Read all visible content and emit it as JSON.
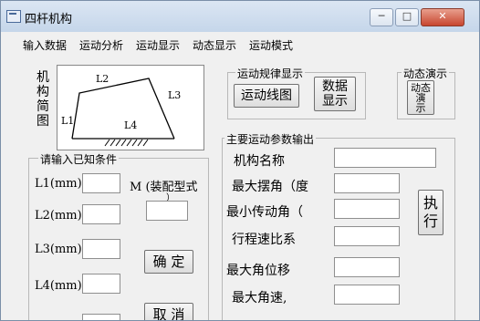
{
  "window": {
    "title": "四杆机构",
    "minimize_glyph": "─",
    "maximize_glyph": "□",
    "close_glyph": "✕"
  },
  "menu": [
    "输入数据",
    "运动分析",
    "运动显示",
    "动态显示",
    "运动模式"
  ],
  "diagram": {
    "caption": "机构简图",
    "labels": {
      "l1": "L1",
      "l2": "L2",
      "l3": "L3",
      "l4": "L4"
    }
  },
  "motion_display": {
    "title": "运动规律显示",
    "diagram_button": "运动线图",
    "data_button_l1": "数据",
    "data_button_l2": "显示"
  },
  "dynamic_demo": {
    "title": "动态演示",
    "button_l1": "动态",
    "button_l2": "演",
    "button_l3": "示"
  },
  "input_frame": {
    "title": "请输入已知条件",
    "fields": [
      {
        "label": "L1(mm):",
        "value": ""
      },
      {
        "label": "L2(mm):",
        "value": ""
      },
      {
        "label": "L3(mm):",
        "value": ""
      },
      {
        "label": "L4(mm):",
        "value": ""
      }
    ],
    "mode_label": "M (装配型式",
    "mode_label_overflow": "）",
    "mode_value": "",
    "confirm_button": "确 定",
    "cancel_button": "取 消"
  },
  "output_frame": {
    "title": "主要运动参数输出",
    "rows": [
      {
        "label": "机构名称",
        "value": ""
      },
      {
        "label": "最大摆角（度",
        "value": ""
      },
      {
        "label": "最小传动角（",
        "value": ""
      },
      {
        "label": "行程速比系",
        "value": ""
      },
      {
        "label": "最大角位移",
        "value": ""
      },
      {
        "label": "最大角速,",
        "value": ""
      }
    ],
    "execute_button_l1": "执",
    "execute_button_l2": "行"
  }
}
